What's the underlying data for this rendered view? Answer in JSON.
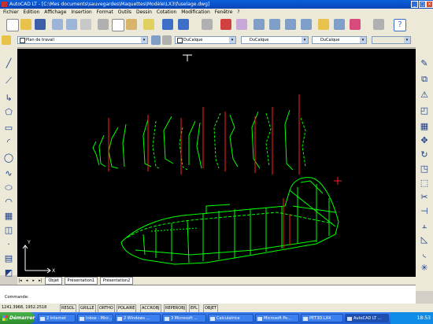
{
  "window": {
    "title": "AutoCAD LT - [C:\\Mes documents\\sauvegardes\\Maquettes\\Modèle\\LX3\\fuselage.dwg]"
  },
  "menu": {
    "items": [
      "Fichier",
      "Edition",
      "Affichage",
      "Insertion",
      "Format",
      "Outils",
      "Dessin",
      "Cotation",
      "Modification",
      "Fenêtre",
      "?"
    ]
  },
  "properties_bar": {
    "layer": "Plan de travail",
    "color": "DuCalque",
    "linetype": "DuCalque",
    "lineweight": "DuCalque"
  },
  "layout_tabs": [
    "Objet",
    "Présentation1",
    "Présentation2"
  ],
  "command_line": {
    "prompt": "Commande:"
  },
  "status_bar": {
    "coordinates": "1241.3968, 1952.2518",
    "buttons": [
      "RESOL",
      "GRILLE",
      "ORTHO",
      "POLAIRE",
      "ACCROBJ",
      "REPEROBJ",
      "EPL",
      "OBJET"
    ]
  },
  "taskbar": {
    "start_label": "Démarrer",
    "tasks": [
      "2 Internet",
      "Inbox - Micr...",
      "2 Windows ...",
      "3 Microsoft ...",
      "Calculatrice",
      "Microsoft Po...",
      "PET3D.LX4",
      "AutoCAD LT ..."
    ],
    "active_task_index": 7,
    "clock": "18:53"
  },
  "colors": {
    "canvas_bg": "#000000",
    "drawing_green": "#00ff00",
    "drawing_red": "#ff2020",
    "cursor": "#ff2020",
    "titlebar": "#0a5fd8"
  }
}
